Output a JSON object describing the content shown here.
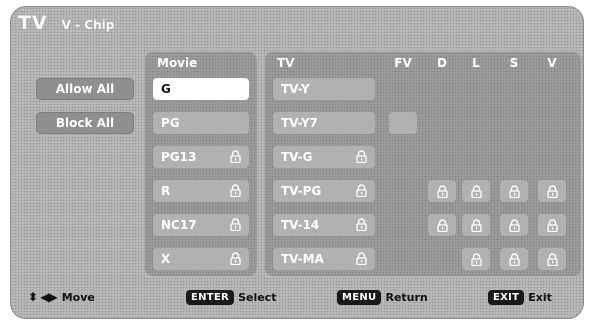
{
  "header": {
    "title": "TV",
    "subtitle": "V - Chip"
  },
  "left_buttons": {
    "allow_all": "Allow All",
    "block_all": "Block All"
  },
  "movie": {
    "heading": "Movie",
    "ratings": [
      {
        "label": "G",
        "locked": false,
        "selected": true
      },
      {
        "label": "PG",
        "locked": false,
        "selected": false
      },
      {
        "label": "PG13",
        "locked": true,
        "selected": false
      },
      {
        "label": "R",
        "locked": true,
        "selected": false
      },
      {
        "label": "NC17",
        "locked": true,
        "selected": false
      },
      {
        "label": "X",
        "locked": true,
        "selected": false
      }
    ]
  },
  "tv": {
    "heading": "TV",
    "content_headers": [
      "FV",
      "D",
      "L",
      "S",
      "V"
    ],
    "ratings": [
      {
        "label": "TV-Y",
        "locked": false,
        "content": []
      },
      {
        "label": "TV-Y7",
        "locked": false,
        "content": [
          "FV"
        ]
      },
      {
        "label": "TV-G",
        "locked": true,
        "content": []
      },
      {
        "label": "TV-PG",
        "locked": true,
        "content": [
          "D",
          "L",
          "S",
          "V"
        ]
      },
      {
        "label": "TV-14",
        "locked": true,
        "content": [
          "D",
          "L",
          "S",
          "V"
        ]
      },
      {
        "label": "TV-MA",
        "locked": true,
        "content": [
          "L",
          "S",
          "V"
        ]
      }
    ]
  },
  "footer": {
    "move_arrows": "⬍ ◀▶",
    "move_label": "Move",
    "enter_key": "ENTER",
    "enter_label": "Select",
    "menu_key": "MENU",
    "menu_label": "Return",
    "exit_key": "EXIT",
    "exit_label": "Exit"
  }
}
